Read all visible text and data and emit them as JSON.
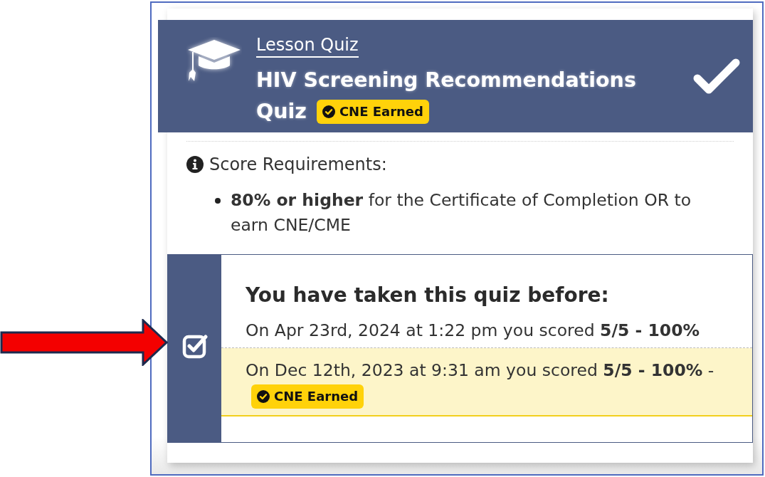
{
  "header": {
    "eyebrow": "Lesson Quiz",
    "title_lines": [
      "HIV Screening Recommendations",
      "Quiz"
    ],
    "badge": "CNE Earned",
    "completed": true
  },
  "requirements": {
    "heading": "Score Requirements:",
    "items": [
      "**80% or higher** for the Certificate of Completion OR to earn CNE/CME"
    ]
  },
  "attempts": {
    "heading": "You have taken this quiz before:",
    "rows": [
      {
        "text": "On Apr 23rd, 2024 at 1:22 pm you scored **5/5 - 100%**",
        "highlighted": false
      },
      {
        "text": "On Dec 12th, 2023 at 9:31 am you scored **5/5 - 100%** -",
        "highlighted": true,
        "badge": "CNE Earned"
      }
    ]
  }
}
